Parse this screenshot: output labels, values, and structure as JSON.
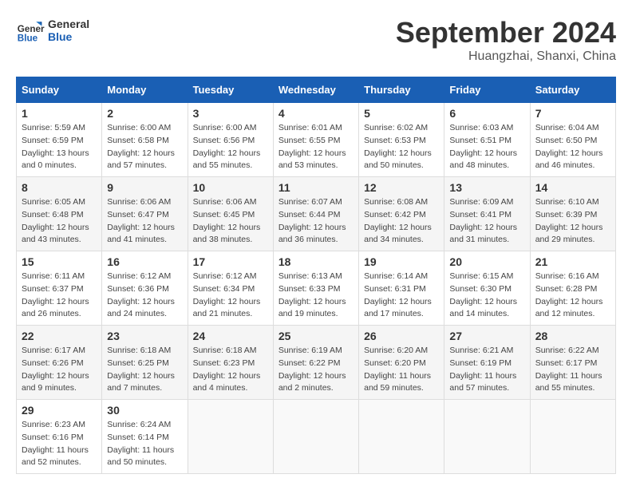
{
  "header": {
    "logo_line1": "General",
    "logo_line2": "Blue",
    "month": "September 2024",
    "location": "Huangzhai, Shanxi, China"
  },
  "weekdays": [
    "Sunday",
    "Monday",
    "Tuesday",
    "Wednesday",
    "Thursday",
    "Friday",
    "Saturday"
  ],
  "weeks": [
    [
      {
        "day": "1",
        "info": "Sunrise: 5:59 AM\nSunset: 6:59 PM\nDaylight: 13 hours\nand 0 minutes."
      },
      {
        "day": "2",
        "info": "Sunrise: 6:00 AM\nSunset: 6:58 PM\nDaylight: 12 hours\nand 57 minutes."
      },
      {
        "day": "3",
        "info": "Sunrise: 6:00 AM\nSunset: 6:56 PM\nDaylight: 12 hours\nand 55 minutes."
      },
      {
        "day": "4",
        "info": "Sunrise: 6:01 AM\nSunset: 6:55 PM\nDaylight: 12 hours\nand 53 minutes."
      },
      {
        "day": "5",
        "info": "Sunrise: 6:02 AM\nSunset: 6:53 PM\nDaylight: 12 hours\nand 50 minutes."
      },
      {
        "day": "6",
        "info": "Sunrise: 6:03 AM\nSunset: 6:51 PM\nDaylight: 12 hours\nand 48 minutes."
      },
      {
        "day": "7",
        "info": "Sunrise: 6:04 AM\nSunset: 6:50 PM\nDaylight: 12 hours\nand 46 minutes."
      }
    ],
    [
      {
        "day": "8",
        "info": "Sunrise: 6:05 AM\nSunset: 6:48 PM\nDaylight: 12 hours\nand 43 minutes."
      },
      {
        "day": "9",
        "info": "Sunrise: 6:06 AM\nSunset: 6:47 PM\nDaylight: 12 hours\nand 41 minutes."
      },
      {
        "day": "10",
        "info": "Sunrise: 6:06 AM\nSunset: 6:45 PM\nDaylight: 12 hours\nand 38 minutes."
      },
      {
        "day": "11",
        "info": "Sunrise: 6:07 AM\nSunset: 6:44 PM\nDaylight: 12 hours\nand 36 minutes."
      },
      {
        "day": "12",
        "info": "Sunrise: 6:08 AM\nSunset: 6:42 PM\nDaylight: 12 hours\nand 34 minutes."
      },
      {
        "day": "13",
        "info": "Sunrise: 6:09 AM\nSunset: 6:41 PM\nDaylight: 12 hours\nand 31 minutes."
      },
      {
        "day": "14",
        "info": "Sunrise: 6:10 AM\nSunset: 6:39 PM\nDaylight: 12 hours\nand 29 minutes."
      }
    ],
    [
      {
        "day": "15",
        "info": "Sunrise: 6:11 AM\nSunset: 6:37 PM\nDaylight: 12 hours\nand 26 minutes."
      },
      {
        "day": "16",
        "info": "Sunrise: 6:12 AM\nSunset: 6:36 PM\nDaylight: 12 hours\nand 24 minutes."
      },
      {
        "day": "17",
        "info": "Sunrise: 6:12 AM\nSunset: 6:34 PM\nDaylight: 12 hours\nand 21 minutes."
      },
      {
        "day": "18",
        "info": "Sunrise: 6:13 AM\nSunset: 6:33 PM\nDaylight: 12 hours\nand 19 minutes."
      },
      {
        "day": "19",
        "info": "Sunrise: 6:14 AM\nSunset: 6:31 PM\nDaylight: 12 hours\nand 17 minutes."
      },
      {
        "day": "20",
        "info": "Sunrise: 6:15 AM\nSunset: 6:30 PM\nDaylight: 12 hours\nand 14 minutes."
      },
      {
        "day": "21",
        "info": "Sunrise: 6:16 AM\nSunset: 6:28 PM\nDaylight: 12 hours\nand 12 minutes."
      }
    ],
    [
      {
        "day": "22",
        "info": "Sunrise: 6:17 AM\nSunset: 6:26 PM\nDaylight: 12 hours\nand 9 minutes."
      },
      {
        "day": "23",
        "info": "Sunrise: 6:18 AM\nSunset: 6:25 PM\nDaylight: 12 hours\nand 7 minutes."
      },
      {
        "day": "24",
        "info": "Sunrise: 6:18 AM\nSunset: 6:23 PM\nDaylight: 12 hours\nand 4 minutes."
      },
      {
        "day": "25",
        "info": "Sunrise: 6:19 AM\nSunset: 6:22 PM\nDaylight: 12 hours\nand 2 minutes."
      },
      {
        "day": "26",
        "info": "Sunrise: 6:20 AM\nSunset: 6:20 PM\nDaylight: 11 hours\nand 59 minutes."
      },
      {
        "day": "27",
        "info": "Sunrise: 6:21 AM\nSunset: 6:19 PM\nDaylight: 11 hours\nand 57 minutes."
      },
      {
        "day": "28",
        "info": "Sunrise: 6:22 AM\nSunset: 6:17 PM\nDaylight: 11 hours\nand 55 minutes."
      }
    ],
    [
      {
        "day": "29",
        "info": "Sunrise: 6:23 AM\nSunset: 6:16 PM\nDaylight: 11 hours\nand 52 minutes."
      },
      {
        "day": "30",
        "info": "Sunrise: 6:24 AM\nSunset: 6:14 PM\nDaylight: 11 hours\nand 50 minutes."
      },
      {
        "day": "",
        "info": ""
      },
      {
        "day": "",
        "info": ""
      },
      {
        "day": "",
        "info": ""
      },
      {
        "day": "",
        "info": ""
      },
      {
        "day": "",
        "info": ""
      }
    ]
  ]
}
